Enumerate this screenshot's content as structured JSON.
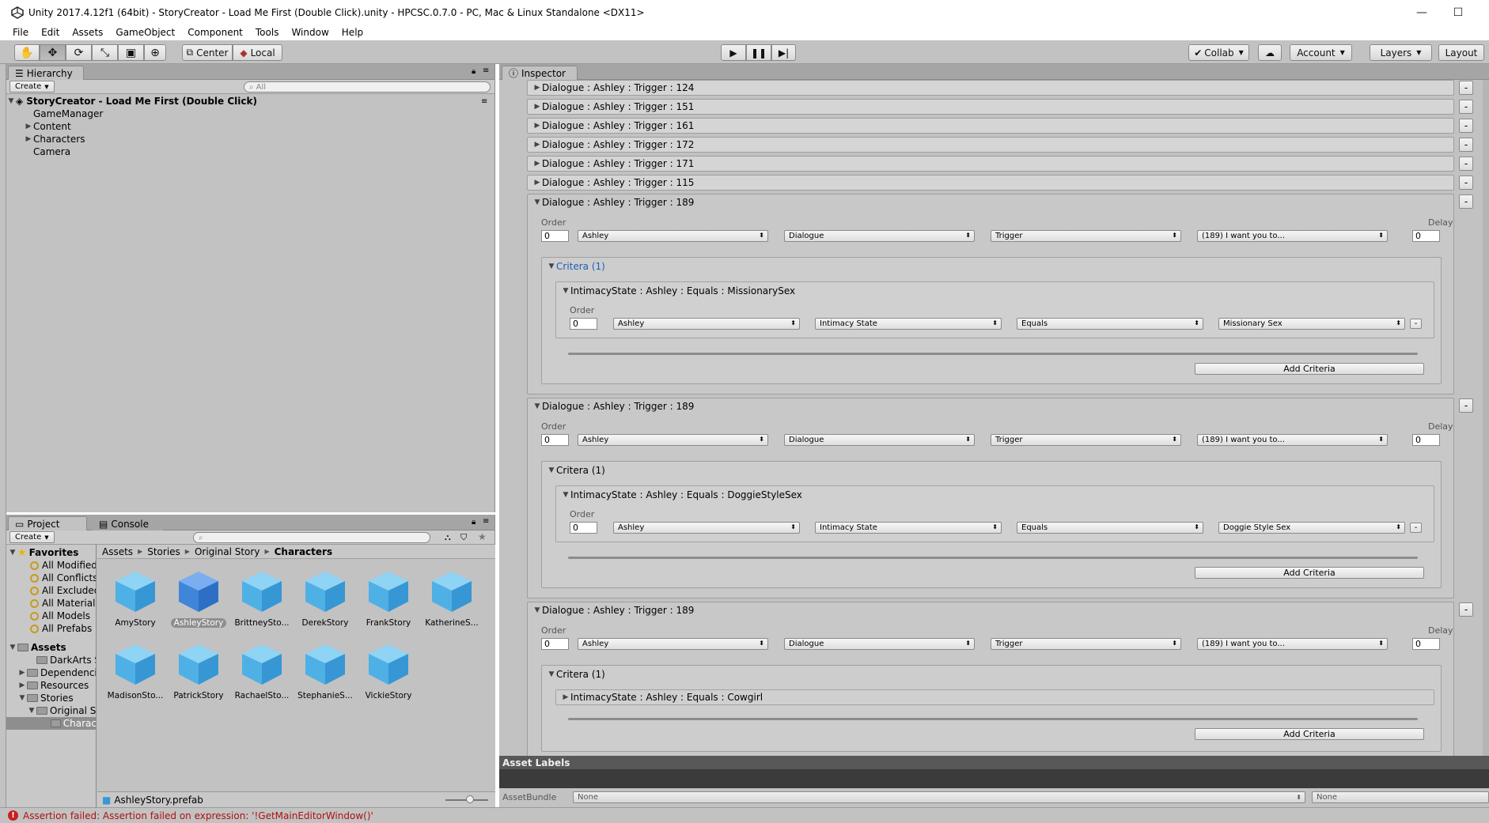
{
  "window": {
    "title": "Unity 2017.4.12f1 (64bit) - StoryCreator - Load Me First (Double Click).unity - HPCSC.0.7.0 - PC, Mac & Linux Standalone <DX11>"
  },
  "menu": [
    "File",
    "Edit",
    "Assets",
    "GameObject",
    "Component",
    "Tools",
    "Window",
    "Help"
  ],
  "toolbar": {
    "pivot": "Center",
    "space": "Local",
    "collab": "Collab",
    "account": "Account",
    "layers": "Layers",
    "layout": "Layout"
  },
  "hierarchy": {
    "tab": "Hierarchy",
    "create": "Create",
    "search_placeholder": "All",
    "scene": "StoryCreator - Load Me First (Double Click)",
    "items": [
      {
        "label": "GameManager",
        "expandable": false
      },
      {
        "label": "Content",
        "expandable": true
      },
      {
        "label": "Characters",
        "expandable": true
      },
      {
        "label": "Camera",
        "expandable": false
      }
    ]
  },
  "project": {
    "tab_project": "Project",
    "tab_console": "Console",
    "create": "Create",
    "favorites": {
      "label": "Favorites",
      "items": [
        "All Modified",
        "All Conflicts",
        "All Excluded",
        "All Materials",
        "All Models",
        "All Prefabs"
      ]
    },
    "assets": {
      "label": "Assets",
      "items": [
        "DarkArts St",
        "Dependenci",
        "Resources",
        "Stories",
        "Original S",
        "Charac"
      ]
    },
    "breadcrumb": [
      "Assets",
      "Stories",
      "Original Story",
      "Characters"
    ],
    "files": [
      "AmyStory",
      "AshleyStory",
      "BrittneySto...",
      "DerekStory",
      "FrankStory",
      "KatherineS...",
      "MadisonSto...",
      "PatrickStory",
      "RachaelSto...",
      "StephanieS...",
      "VickieStory"
    ],
    "selected_file": "AshleyStory",
    "status_file": "AshleyStory.prefab"
  },
  "inspector": {
    "tab": "Inspector",
    "collapsed": [
      "Dialogue : Ashley : Trigger : 124",
      "Dialogue : Ashley : Trigger : 151",
      "Dialogue : Ashley : Trigger : 161",
      "Dialogue : Ashley : Trigger : 172",
      "Dialogue : Ashley : Trigger : 171",
      "Dialogue : Ashley : Trigger : 115"
    ],
    "labels": {
      "order": "Order",
      "delay": "Delay",
      "add_criteria": "Add Criteria",
      "remove": "-"
    },
    "dialogues": [
      {
        "title": "Dialogue : Ashley : Trigger : 189",
        "order": "0",
        "delay": "0",
        "character": "Ashley",
        "type": "Dialogue",
        "trigger": "Trigger",
        "line": "(189) I want you to...",
        "criteria_title": "Critera (1)",
        "criterion": {
          "title": "IntimacyState : Ashley : Equals : MissionarySex",
          "expanded": true,
          "order": "0",
          "character": "Ashley",
          "state": "Intimacy State",
          "op": "Equals",
          "value": "Missionary Sex"
        }
      },
      {
        "title": "Dialogue : Ashley : Trigger : 189",
        "order": "0",
        "delay": "0",
        "character": "Ashley",
        "type": "Dialogue",
        "trigger": "Trigger",
        "line": "(189) I want you to...",
        "criteria_title": "Critera (1)",
        "criterion": {
          "title": "IntimacyState : Ashley : Equals : DoggieStyleSex",
          "expanded": true,
          "order": "0",
          "character": "Ashley",
          "state": "Intimacy State",
          "op": "Equals",
          "value": "Doggie Style Sex"
        }
      },
      {
        "title": "Dialogue : Ashley : Trigger : 189",
        "order": "0",
        "delay": "0",
        "character": "Ashley",
        "type": "Dialogue",
        "trigger": "Trigger",
        "line": "(189) I want you to...",
        "criteria_title": "Critera (1)",
        "criterion": {
          "title": "IntimacyState : Ashley : Equals : Cowgirl",
          "expanded": false
        }
      }
    ],
    "asset_labels": "Asset Labels",
    "assetbundle_label": "AssetBundle",
    "assetbundle_value": "None",
    "assetbundle_variant": "None"
  },
  "status": {
    "message": "Assertion failed: Assertion failed on expression: '!GetMainEditorWindow()'"
  },
  "colors": {
    "accent_blue": "#1c5fb8",
    "error_red": "#b01010",
    "panel": "#c2c2c2"
  }
}
